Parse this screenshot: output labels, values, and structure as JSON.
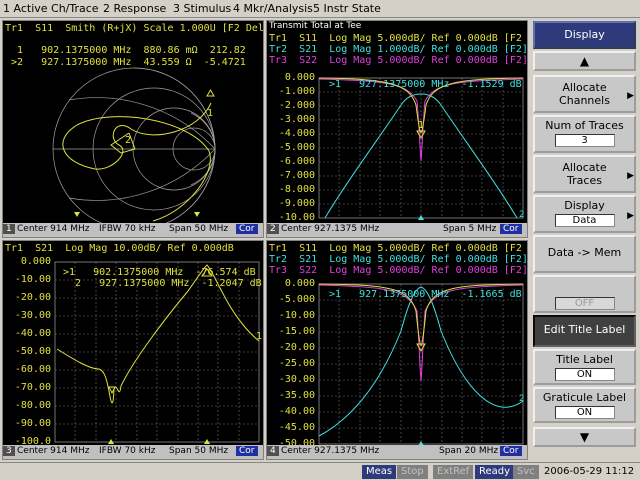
{
  "menubar": {
    "items": [
      "1 Active Ch/Trace",
      "2 Response",
      "3 Stimulus",
      "4 Mkr/Analysis",
      "5 Instr State"
    ]
  },
  "win1": {
    "num": "1",
    "title": "Tr1  S11  Smith (R+jX) Scale 1.000U [F2 Del",
    "markers": [
      "  1   902.1375000 MHz  880.86 mΩ  212.82",
      " >2   927.1375000 MHz  43.559 Ω  -5.4721"
    ],
    "status": {
      "center": "Center 914 MHz",
      "ifbw": "IFBW 70 kHz",
      "span": "Span 50 MHz",
      "cor": "Cor"
    }
  },
  "win2": {
    "num": "2",
    "window_title": "Transmit Total at Tee",
    "traces": [
      "Tr1  S11  Log Mag 5.000dB/ Ref 0.000dB [F2",
      "Tr2  S21  Log Mag 1.000dB/ Ref 0.000dB [F2]",
      "Tr3  S22  Log Mag 5.000dB/ Ref 0.000dB [F2]"
    ],
    "marker": ">1   927.1375000 MHz  -1.1529 dB",
    "yticks": [
      "0.000",
      "-1.000",
      "-2.000",
      "-3.000",
      "-4.000",
      "-5.000",
      "-6.000",
      "-7.000",
      "-8.000",
      "-9.000",
      "-10.00"
    ],
    "status": {
      "center": "Center 927.1375 MHz",
      "span": "Span 5 MHz",
      "cor": "Cor"
    }
  },
  "win3": {
    "num": "3",
    "title": "Tr1  S21  Log Mag 10.00dB/ Ref 0.000dB",
    "markers": [
      ">1   902.1375000 MHz  -76.574 dB",
      "  2   927.1375000 MHz  -1.2047 dB"
    ],
    "yticks": [
      "0.000",
      "-10.00",
      "-20.00",
      "-30.00",
      "-40.00",
      "-50.00",
      "-60.00",
      "-70.00",
      "-80.00",
      "-90.00",
      "-100.0"
    ],
    "status": {
      "center": "Center 914 MHz",
      "ifbw": "IFBW 70 kHz",
      "span": "Span 50 MHz",
      "cor": "Cor"
    }
  },
  "win4": {
    "num": "4",
    "traces": [
      "Tr1  S11  Log Mag 5.000dB/ Ref 0.000dB [F2",
      "Tr2  S21  Log Mag 5.000dB/ Ref 0.000dB [F2]",
      "Tr3  S22  Log Mag 5.000dB/ Ref 0.000dB [F2]"
    ],
    "marker": ">1   927.1375000 MHz  -1.1665 dB",
    "yticks": [
      "0.000",
      "-5.000",
      "-10.00",
      "-15.00",
      "-20.00",
      "-25.00",
      "-30.00",
      "-35.00",
      "-40.00",
      "-45.00",
      "-50.00"
    ],
    "status": {
      "center": "Center 927.1375 MHz",
      "span": "Span 20 MHz",
      "cor": "Cor"
    }
  },
  "softkeys": {
    "display": "Display",
    "allocate_channels": "Allocate Channels",
    "num_traces_label": "Num of Traces",
    "num_traces_value": "3",
    "allocate_traces": "Allocate Traces",
    "display_label": "Display",
    "display_value": "Data",
    "data_mem": "Data -> Mem",
    "off_value": "OFF",
    "edit_title": "Edit Title Label",
    "title_label": "Title Label",
    "title_label_value": "ON",
    "graticule_label": "Graticule Label",
    "graticule_label_value": "ON",
    "up": "▲",
    "down": "▼"
  },
  "statusbar": {
    "meas": "Meas",
    "stop": "Stop",
    "extref": "ExtRef",
    "ready": "Ready",
    "svc": "Svc",
    "datetime": "2006-05-29 11:12"
  },
  "colors": {
    "tr1": "#e0e040",
    "tr2": "#40e0e0",
    "tr3": "#e040e0",
    "grid": "#707070",
    "smith": "#a0a0a0"
  }
}
